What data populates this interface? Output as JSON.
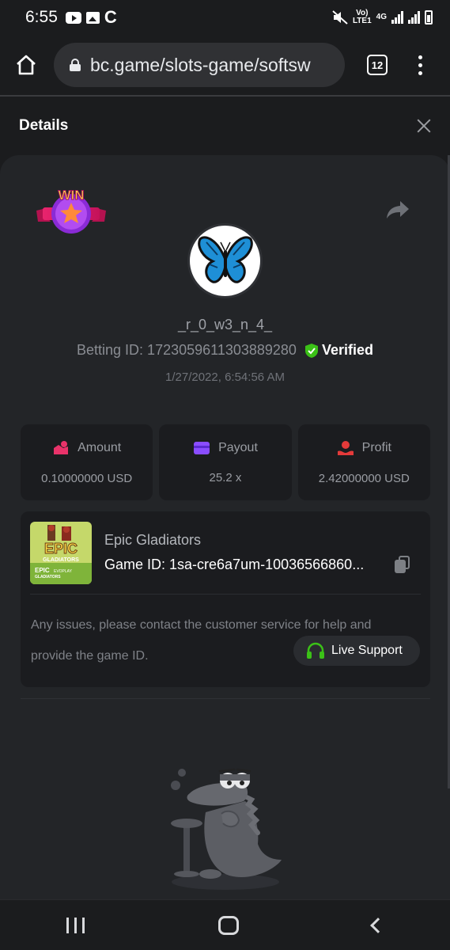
{
  "status_bar": {
    "time": "6:55",
    "c_glyph": "C",
    "network_top": "Vo)",
    "network_bottom": "LTE1",
    "network_type": "4G"
  },
  "browser": {
    "url": "bc.game/slots-game/softsw",
    "tab_count": "12"
  },
  "details": {
    "title": "Details"
  },
  "bet": {
    "username": "_r_0_w3_n_4_",
    "betting_id_label": "Betting ID: 1723059611303889280",
    "verified_label": "Verified",
    "datetime": "1/27/2022, 6:54:56 AM"
  },
  "stats": [
    {
      "label": "Amount",
      "value": "0.10000000 USD",
      "icon": "amount-icon",
      "color": "#e9336a"
    },
    {
      "label": "Payout",
      "value": "25.2 x",
      "icon": "payout-icon",
      "color": "#8a4dff"
    },
    {
      "label": "Profit",
      "value": "2.42000000 USD",
      "icon": "profit-icon",
      "color": "#e43a3a"
    }
  ],
  "game": {
    "name": "Epic Gladiators",
    "game_id": "Game ID: 1sa-cre6a7um-10036566860...",
    "thumb_title": "EPIC",
    "thumb_sub": "GLADIATORS",
    "thumb_logo_text": "EPIC",
    "thumb_logo_brand": "EVOPLAY",
    "thumb_logo_sub": "GLADIATORS",
    "help_text": "Any issues, please contact the customer service for help and provide the game ID.",
    "live_support_label": "Live Support"
  },
  "win_badge_text": "WIN",
  "colors": {
    "background": "#1b1c1e",
    "panel": "#232528",
    "card": "#1b1c1f",
    "verified_green": "#3bc117",
    "support_green": "#3bc117"
  }
}
